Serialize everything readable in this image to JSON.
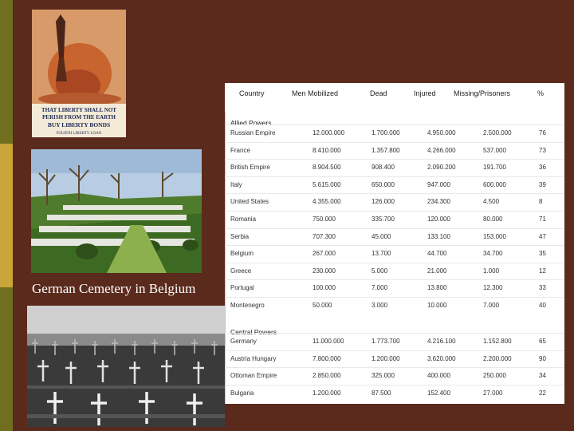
{
  "caption": "German Cemetery in Belgium",
  "poster": {
    "line1": "THAT LIBERTY SHALL NOT",
    "line2": "PERISH FROM THE EARTH",
    "line3": "BUY LIBERTY BONDS",
    "line4": "FOURTH LIBERTY LOAN"
  },
  "table": {
    "headers": [
      "Country",
      "Men Mobilized",
      "Dead",
      "Injured",
      "Missing/Prisoners",
      "%"
    ],
    "groups": [
      {
        "label": "Allied Powers",
        "rows": [
          [
            "Russian Empire",
            "12.000.000",
            "1.700.000",
            "4.950.000",
            "2.500.000",
            "76"
          ],
          [
            "France",
            "8.410.000",
            "1.357.800",
            "4.266.000",
            "537.000",
            "73"
          ],
          [
            "British Empire",
            "8.904.500",
            "908.400",
            "2.090.200",
            "191.700",
            "36"
          ],
          [
            "Italy",
            "5.615.000",
            "650.000",
            "947.000",
            "600.000",
            "39"
          ],
          [
            "United States",
            "4.355.000",
            "126.000",
            "234.300",
            "4.500",
            "8"
          ],
          [
            "Romania",
            "750.000",
            "335.700",
            "120.000",
            "80.000",
            "71"
          ],
          [
            "Serbia",
            "707.300",
            "45.000",
            "133.100",
            "153.000",
            "47"
          ],
          [
            "Belgium",
            "267.000",
            "13.700",
            "44.700",
            "34.700",
            "35"
          ],
          [
            "Greece",
            "230.000",
            "5.000",
            "21.000",
            "1.000",
            "12"
          ],
          [
            "Portugal",
            "100.000",
            "7.000",
            "13.800",
            "12.300",
            "33"
          ],
          [
            "Montenegro",
            "50.000",
            "3.000",
            "10.000",
            "7.000",
            "40"
          ]
        ]
      },
      {
        "label": "Central Powers",
        "rows": [
          [
            "Germany",
            "11.000.000",
            "1.773.700",
            "4.216.100",
            "1.152.800",
            "65"
          ],
          [
            "Austria Hungary",
            "7.800.000",
            "1.200.000",
            "3.620.000",
            "2.200.000",
            "90"
          ],
          [
            "Ottoman Empire",
            "2.850.000",
            "325.000",
            "400.000",
            "250.000",
            "34"
          ],
          [
            "Bulgaria",
            "1.200.000",
            "87.500",
            "152.400",
            "27.000",
            "22"
          ]
        ]
      }
    ]
  }
}
